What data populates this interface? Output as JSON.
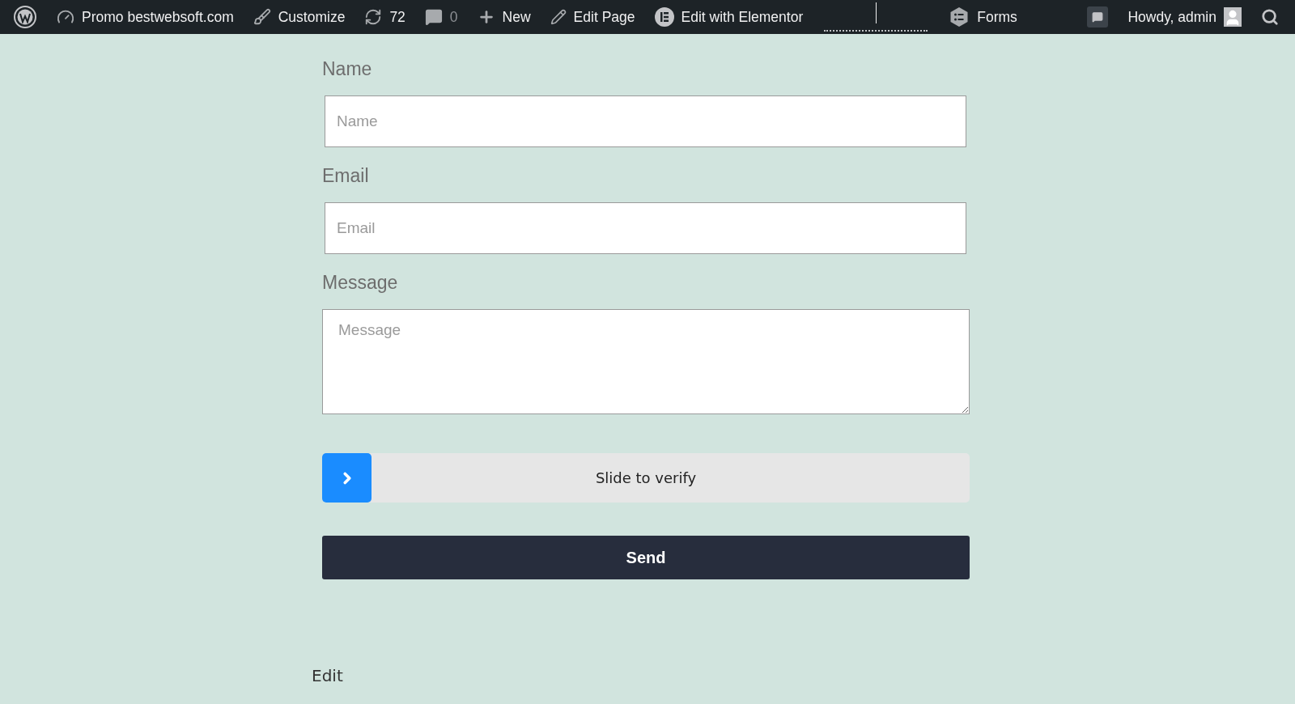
{
  "admin_bar": {
    "items": [
      {
        "kind": "wp"
      },
      {
        "kind": "site",
        "label": "Promo bestwebsoft.com"
      },
      {
        "kind": "customize",
        "label": "Customize"
      },
      {
        "kind": "updates",
        "label": "72"
      },
      {
        "kind": "comments",
        "label": "0",
        "disabled": true
      },
      {
        "kind": "new",
        "label": "New"
      },
      {
        "kind": "edit",
        "label": "Edit Page"
      },
      {
        "kind": "elementor",
        "label": "Edit with Elementor"
      },
      {
        "kind": "blank"
      },
      {
        "kind": "forms",
        "label": "Forms"
      }
    ],
    "right": [
      {
        "kind": "notice"
      },
      {
        "kind": "account",
        "label": "Howdy, admin"
      },
      {
        "kind": "search"
      }
    ]
  },
  "form": {
    "fields": [
      {
        "kind": "input",
        "label": "Name",
        "placeholder": "Name"
      },
      {
        "kind": "input",
        "label": "Email",
        "placeholder": "Email"
      },
      {
        "kind": "textarea",
        "label": "Message",
        "placeholder": "Message"
      }
    ],
    "slider": {
      "text": "Slide to verify",
      "level": 0
    },
    "submit": "Send"
  },
  "edit_link": "Edit"
}
